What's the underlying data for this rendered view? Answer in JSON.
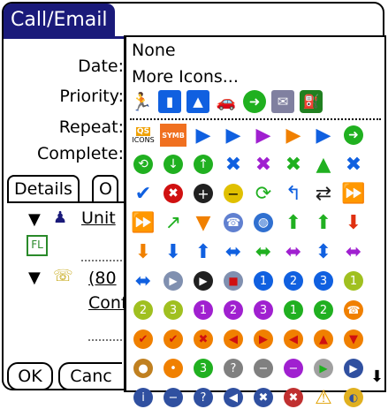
{
  "window": {
    "title": "Call/Email"
  },
  "fields": {
    "date_label": "Date:",
    "priority_label": "Priority:",
    "repeat_label": "Repeat:",
    "complete_label": "Complete:"
  },
  "tabs": {
    "details_label": "Details",
    "other_label": "O"
  },
  "details": {
    "row1_text": "Unit",
    "row3_text": "(80",
    "row4_text": "Conf"
  },
  "buttons": {
    "ok_label": "OK",
    "cancel_label": "Canc"
  },
  "popup": {
    "none_label": "None",
    "more_icons_label": "More Icons...",
    "top_icons": [
      "runner-icon",
      "bar-chart-icon",
      "area-chart-icon",
      "car-icon",
      "right-arrow-circle-icon",
      "envelope-icon",
      "fuel-icon"
    ],
    "grid_labels": {
      "qs_icons_label": "QS\nICONS",
      "symbols_label": "SYMB\nOLS"
    }
  },
  "colors": {
    "title_bg": "#1a1a7a",
    "blue_icon": "#1060e0",
    "green_icon": "#20b020",
    "purple_icon": "#a020d0",
    "orange_icon": "#f08000",
    "red_icon": "#d01010",
    "yellow_icon": "#e0c000"
  }
}
